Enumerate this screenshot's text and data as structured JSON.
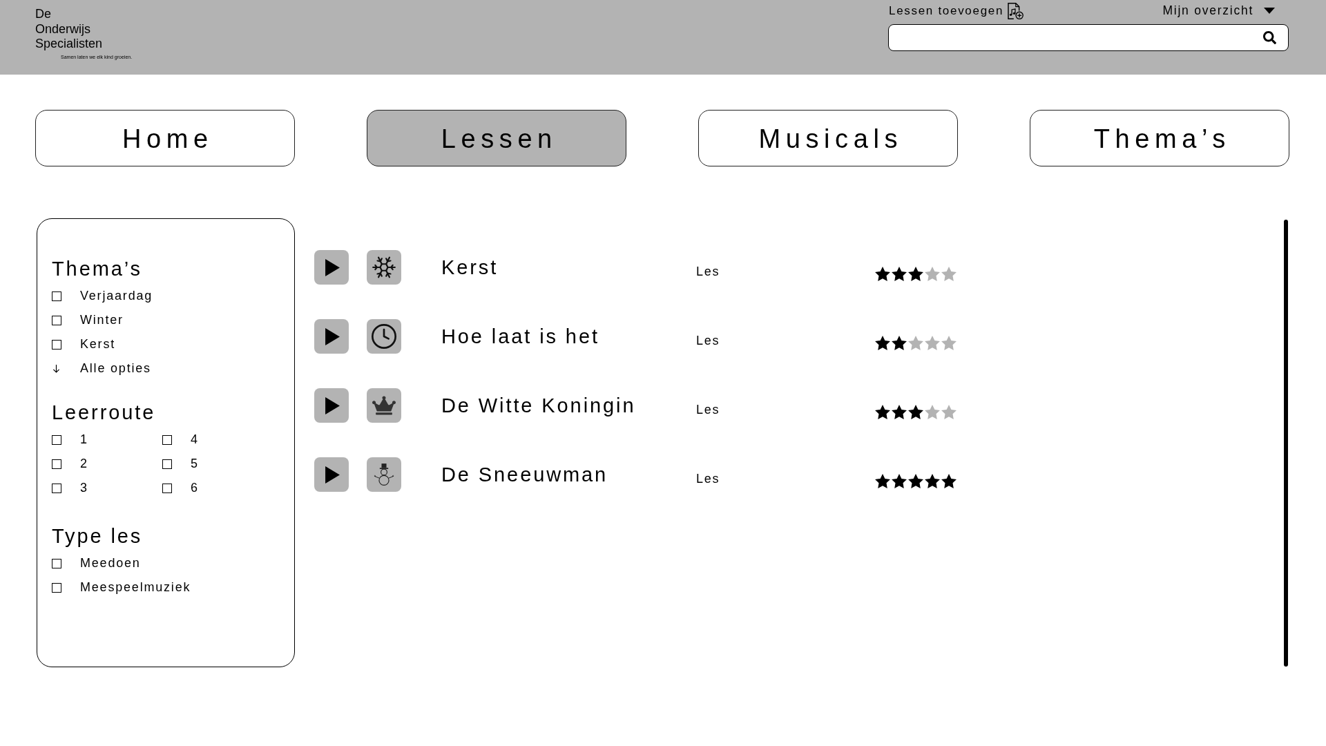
{
  "header": {
    "logo": {
      "name": "De Onderwijs Specialisten",
      "tagline": "Samen laten we elk kind groeien."
    },
    "add_lessons": "Lessen toevoegen",
    "account_menu": "Mijn overzicht"
  },
  "nav": [
    {
      "label": "Home",
      "selected": false
    },
    {
      "label": "Lessen",
      "selected": true
    },
    {
      "label": "Musicals",
      "selected": false
    },
    {
      "label": "Thema’s",
      "selected": false
    }
  ],
  "filters": [
    {
      "title": "Thema’s",
      "kind": "list",
      "options": [
        {
          "label": "Verjaardag",
          "checked": false
        },
        {
          "label": "Winter",
          "checked": false
        },
        {
          "label": "Kerst",
          "checked": false
        }
      ],
      "more": "Alle opties"
    },
    {
      "title": "Leerroute",
      "kind": "grid",
      "options": [
        {
          "label": "1",
          "checked": false
        },
        {
          "label": "2",
          "checked": false
        },
        {
          "label": "3",
          "checked": false
        },
        {
          "label": "4",
          "checked": false
        },
        {
          "label": "5",
          "checked": false
        },
        {
          "label": "6",
          "checked": false
        }
      ]
    },
    {
      "title": "Type les",
      "kind": "list",
      "options": [
        {
          "label": "Meedoen",
          "checked": false
        },
        {
          "label": "Meespeelmuziek",
          "checked": false
        }
      ]
    }
  ],
  "lessons": [
    {
      "title": "Kerst",
      "type": "Les",
      "stars": 3
    },
    {
      "title": "Hoe laat is het",
      "type": "Les",
      "stars": 2
    },
    {
      "title": "De Witte Koningin",
      "type": "Les",
      "stars": 3
    },
    {
      "title": "De Sneeuwman",
      "type": "Les",
      "stars": 5
    }
  ]
}
